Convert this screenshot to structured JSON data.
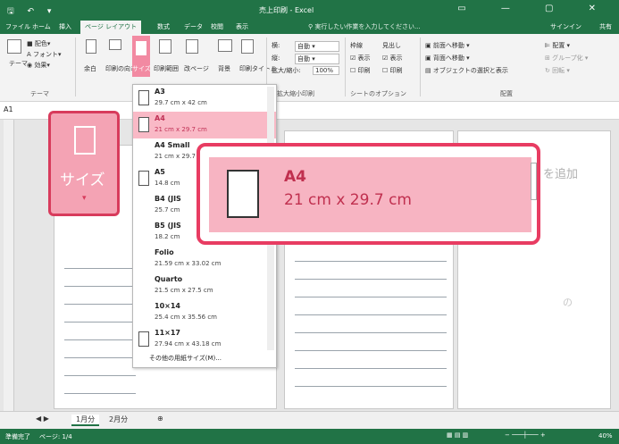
{
  "window": {
    "title": "売上印刷 - Excel",
    "sign_in": "サインイン",
    "share": "共有",
    "tell_me": "実行したい作業を入力してください..."
  },
  "tabs": [
    {
      "label": "ファイル",
      "active": false
    },
    {
      "label": "ホーム",
      "active": false
    },
    {
      "label": "挿入",
      "active": false
    },
    {
      "label": "ページ レイアウト",
      "active": true
    },
    {
      "label": "数式",
      "active": false
    },
    {
      "label": "データ",
      "active": false
    },
    {
      "label": "校閲",
      "active": false
    },
    {
      "label": "表示",
      "active": false
    }
  ],
  "ribbon": {
    "theme": {
      "themes": "テーマ",
      "colors": "配色",
      "fonts": "フォント",
      "effects": "効果",
      "group": "テーマ"
    },
    "page_setup": {
      "margins": "余白",
      "orientation": "印刷の向き",
      "size": "サイズ",
      "print_area": "印刷範囲",
      "breaks": "改ページ",
      "background": "背景",
      "print_titles": "印刷タイトル"
    },
    "scale": {
      "width_label": "横:",
      "width_value": "自動",
      "height_label": "縦:",
      "height_value": "自動",
      "scale_label": "拡大/縮小:",
      "scale_value": "100%",
      "group": "拡大縮小印刷"
    },
    "sheet_options": {
      "gridlines": "枠線",
      "headings": "見出し",
      "view1": "表示",
      "view2": "表示",
      "print1": "印刷",
      "print2": "印刷",
      "group": "シートのオプション"
    },
    "arrange": {
      "bring_forward": "前面へ移動",
      "send_backward": "背面へ移動",
      "selection_pane": "オブジェクトの選択と表示",
      "align": "配置",
      "group_btn": "グループ化",
      "rotate": "回転",
      "group": "配置"
    }
  },
  "formula_bar": {
    "name_box": "A1"
  },
  "size_menu": {
    "items": [
      {
        "name": "A3",
        "dim": "29.7 cm x 42 cm",
        "selected": false,
        "icon": true
      },
      {
        "name": "A4",
        "dim": "21 cm x 29.7 cm",
        "selected": true,
        "icon": true
      },
      {
        "name": "A4 Small",
        "dim": "21 cm x 29.7 cm",
        "selected": false,
        "icon": false
      },
      {
        "name": "A5",
        "dim": "14.8 cm",
        "selected": false,
        "icon": true
      },
      {
        "name": "B4 (JIS",
        "dim": "25.7 cm",
        "selected": false,
        "icon": false
      },
      {
        "name": "B5 (JIS",
        "dim": "18.2 cm",
        "selected": false,
        "icon": false
      },
      {
        "name": "Folio",
        "dim": "21.59 cm x 33.02 cm",
        "selected": false,
        "icon": false
      },
      {
        "name": "Quarto",
        "dim": "21.5 cm x 27.5 cm",
        "selected": false,
        "icon": false
      },
      {
        "name": "10×14",
        "dim": "25.4 cm x 35.56 cm",
        "selected": false,
        "icon": false
      },
      {
        "name": "11×17",
        "dim": "27.94 cm x 43.18 cm",
        "selected": false,
        "icon": true
      }
    ],
    "more_sizes": "その他の用紙サイズ(M)..."
  },
  "callouts": {
    "size_label": "サイズ",
    "a4_name": "A4",
    "a4_dim": "21 cm x 29.7 cm"
  },
  "sheet": {
    "faint_add": "を追加",
    "faint_left": "の"
  },
  "sheet_tabs": [
    {
      "label": "1月分",
      "active": true
    },
    {
      "label": "2月分",
      "active": false
    }
  ],
  "status": {
    "ready": "準備完了",
    "page": "ページ: 1/4",
    "zoom": "40%"
  },
  "colors": {
    "excel_green": "#217346",
    "highlight_pink": "#f9b9c6",
    "callout_red": "#e83c62"
  }
}
